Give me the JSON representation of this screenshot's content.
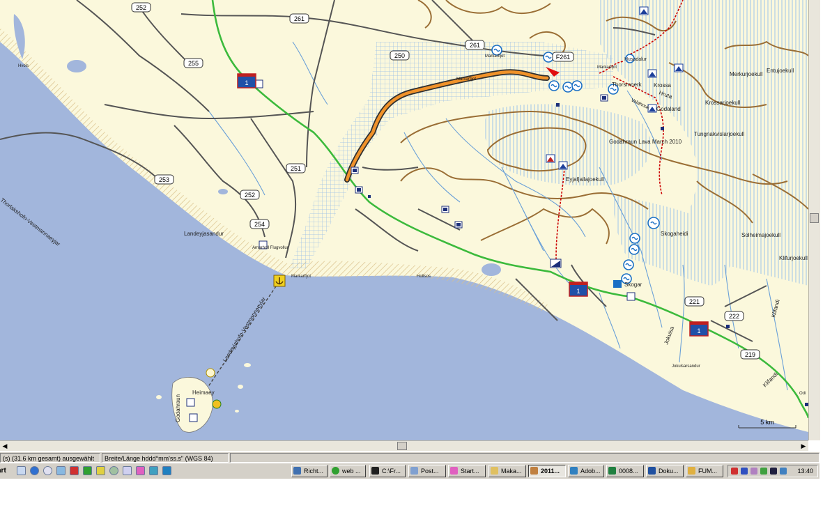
{
  "map": {
    "road_shields": [
      "252",
      "261",
      "255",
      "250",
      "261",
      "F261",
      "253",
      "251",
      "252",
      "254",
      "221",
      "222",
      "219"
    ],
    "highway_shields": [
      "1",
      "1",
      "1"
    ],
    "place_labels": {
      "hvolsvollur": "Hvols",
      "markarfljot_top": "Markarfljot",
      "markarfljot_mid": "Markarfljot",
      "markarfljot_right": "Markarfljot",
      "thorsmork": "Thorsmoerk",
      "krossa": "Krossa",
      "husadalur": "Husadalur",
      "hruta": "Hruta",
      "valahnukur": "Valahnuk",
      "godaland": "Godaland",
      "merkurjoekull": "Merkurjoekull",
      "entujoekull": "Entujoekull",
      "krossarjoekull": "Krossarjoekull",
      "tungnakvislarjoekull": "Tungnakvislarjoekull",
      "eruption": "Godahraun Lava March 2010",
      "eyjafjallajoekull": "Eyjafjallajoekull",
      "skogaheidi": "Skogaheidi",
      "solheimajoekull": "Solheimajoekull",
      "klifurjoekull": "Klifurjoekull",
      "skogar": "Skogar",
      "landeyjasandur": "Landeyjasandur",
      "arnarholl": "Arnarholl Flugvollur",
      "markarfljot_mouth": "Markarfljot",
      "holtsos": "Holtsos",
      "ferry": "Landeyjahofn-Vestmannaeyjar",
      "ferry2": "Thorlakshofn-Vestmannaeyjar",
      "jokulsa": "Jokulsa",
      "klifandi": "Klifandi",
      "klifandi2": "Klifandi",
      "heimaey": "Heimaey",
      "godahraun": "Godahraun",
      "jokulsa_mouth": "Jokulsarsandur",
      "odi": "Odi",
      "scale": "5 km"
    }
  },
  "statusbar": {
    "selection": "(s) (31.6 km gesamt) ausgewählt",
    "position_format": "Breite/Länge hddd°mm'ss.s\" (WGS 84)"
  },
  "taskbar": {
    "start_label": "Start",
    "tasks": [
      "Richt...",
      "web ...",
      "C:\\Fr...",
      "Post...",
      "Start...",
      "Maka...",
      "2011...",
      "Adob...",
      "0008...",
      "Doku...",
      "FUM..."
    ],
    "active_task_index": 6,
    "clock": "13:40"
  },
  "colors": {
    "land": "#fbf8dc",
    "sea": "#a2b6dc",
    "glacier_lines": "#9ec3ea",
    "river": "#6aa0d8",
    "contour": "#9a6e35",
    "road": "#555555",
    "highway": "#3cba3c",
    "track": "#f0922a",
    "track_outline": "#303030",
    "trail": "#cc0000",
    "sand": "#e2cfa4"
  }
}
